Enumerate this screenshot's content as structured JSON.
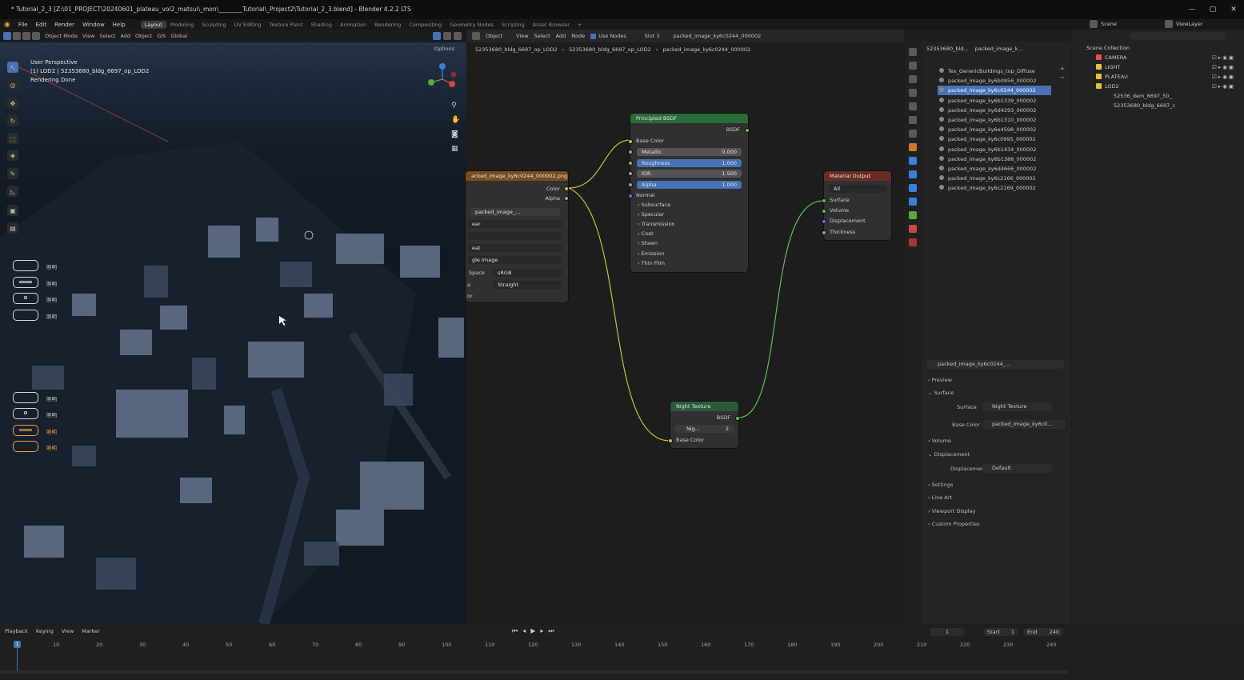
{
  "titlebar": {
    "title": "* Tutorial_2_3 [Z:\\01_PROJECT\\20240601_plateau_vol2_matsui\\_mon\\________Tutorial\\_Project2\\Tutorial_2_3.blend] - Blender 4.2.2 LTS",
    "min": "—",
    "max": "▢",
    "close": "✕"
  },
  "menu": [
    "File",
    "Edit",
    "Render",
    "Window",
    "Help"
  ],
  "workspaces": [
    "Layout",
    "Modeling",
    "Sculpting",
    "UV Editing",
    "Texture Paint",
    "Shading",
    "Animation",
    "Rendering",
    "Compositing",
    "Geometry Nodes",
    "Scripting",
    "Asset Browser",
    "+"
  ],
  "scene": {
    "scene": "Scene",
    "viewlayer": "ViewLayer"
  },
  "viewport": {
    "header": [
      "Object Mode",
      "View",
      "Select",
      "Add",
      "Object",
      "GIS",
      "Global"
    ],
    "options": "Options",
    "overlay": [
      "User Perspective",
      "(1) LOD2 | 52353680_bldg_6697_op_LOD2",
      "Rendering Done"
    ],
    "ctl_labels": [
      "照明",
      "照明",
      "照明",
      "照明",
      "照明",
      "照明",
      "照明",
      "照明"
    ]
  },
  "node_editor": {
    "header": [
      "Object",
      "View",
      "Select",
      "Add",
      "Node",
      "Use Nodes",
      "Slot 3",
      "packed_image_ky6c0244_000002"
    ],
    "breadcrumb": [
      "52353680_bldg_6697_op_LOD2",
      "52353680_bldg_6697_op_LOD2",
      "packed_image_ky6c0244_000002"
    ],
    "image_node": {
      "title": "acked_image_ky6c0244_000002.png",
      "out_color": "Color",
      "out_alpha": "Alpha",
      "image": "packed_image_...",
      "rows": [
        "ear",
        "",
        "eat",
        "gle Image"
      ],
      "space_lbl": "Space",
      "space_val": "sRGB",
      "alpha_lbl": "a",
      "alpha_val": "Straight",
      "last": "or"
    },
    "bsdf": {
      "title": "Principled BSDF",
      "out": "BSDF",
      "base": "Base Color",
      "fields": [
        {
          "name": "Metallic",
          "value": "0.000",
          "hi": false
        },
        {
          "name": "Roughness",
          "value": "1.000",
          "hi": true
        },
        {
          "name": "IOR",
          "value": "1.500",
          "hi": false
        },
        {
          "name": "Alpha",
          "value": "1.000",
          "hi": true
        }
      ],
      "normal": "Normal",
      "panels": [
        "Subsurface",
        "Specular",
        "Transmission",
        "Coat",
        "Sheen",
        "Emission",
        "Thin Film"
      ]
    },
    "output": {
      "title": "Material Output",
      "target": "All",
      "inputs": [
        "Surface",
        "Volume",
        "Displacement",
        "Thickness"
      ]
    },
    "night": {
      "title": "Night Texture",
      "out": "BSDF",
      "group": "Nig...",
      "users": "2",
      "input": "Base Color"
    }
  },
  "materials": {
    "header": "52353680_bld...",
    "active": "packed_image_k...",
    "slots": [
      "Tex_GenericBuildings_top_Diffuse",
      "packed_image_ky6b0956_000002",
      "packed_image_ky6c0244_000002",
      "packed_image_ky6b1339_000002",
      "packed_image_ky6d4293_000002",
      "packed_image_ky6b1310_000002",
      "packed_image_ky6e4598_000002",
      "packed_image_ky6c0995_000002",
      "packed_image_ky6b1434_000002",
      "packed_image_ky6b1388_000002",
      "packed_image_ky6d4666_000002",
      "packed_image_ky6c2166_000002",
      "packed_image_ky6c2169_000002"
    ],
    "selected": 2
  },
  "props": {
    "material": "packed_image_ky6c0244_...",
    "preview": "Preview",
    "surface_sec": "Surface",
    "surface_lbl": "Surface",
    "surface_val": "Night Texture",
    "base_lbl": "Base Color",
    "base_val": "packed_image_ky6c0...",
    "volume": "Volume",
    "disp_sec": "Displacement",
    "disp_lbl": "Displacement",
    "disp_val": "Default",
    "settings": "Settings",
    "lineart": "Line Art",
    "vpdisplay": "Viewport Display",
    "custom": "Custom Properties"
  },
  "outliner": {
    "root": "Scene Collection",
    "items": [
      {
        "name": "CAMERA",
        "color": "#e05050"
      },
      {
        "name": "LIGHT",
        "color": "#e8c13a"
      },
      {
        "name": "PLATEAU",
        "color": "#e8c13a"
      },
      {
        "name": "LOD2",
        "color": "#e8c13a"
      }
    ],
    "children": [
      "52536_dem_6697_50_",
      "52353680_bldg_6697_c"
    ]
  },
  "timeline": {
    "menu": [
      "Playback",
      "Keying",
      "View",
      "Marker"
    ],
    "current": "1",
    "start_lbl": "Start",
    "start": "1",
    "end_lbl": "End",
    "end": "240",
    "ticks": [
      "10",
      "20",
      "30",
      "40",
      "50",
      "60",
      "70",
      "80",
      "90",
      "100",
      "110",
      "120",
      "130",
      "140",
      "150",
      "160",
      "170",
      "180",
      "190",
      "200",
      "210",
      "220",
      "230",
      "240"
    ]
  }
}
